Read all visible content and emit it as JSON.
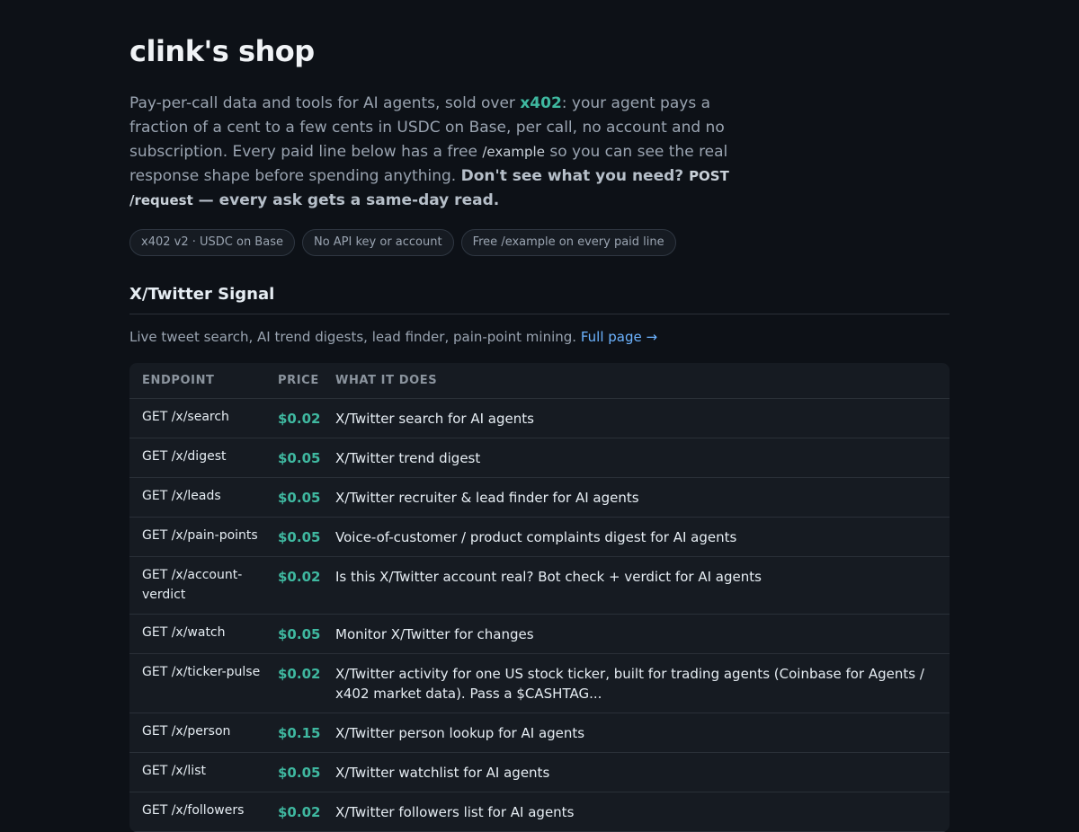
{
  "header": {
    "title": "clink's shop"
  },
  "intro": {
    "part1": "Pay-per-call data and tools for AI agents, sold over ",
    "accent": "x402",
    "part2": ": your agent pays a fraction of a cent to a few cents in USDC on Base, per call, no account and no subscription. Every paid line below has a free ",
    "code1": "/example",
    "part3": " so you can see the real response shape before spending anything. ",
    "strong1": "Don't see what you need? ",
    "code2": "POST /request",
    "strong2": " — every ask gets a same-day read."
  },
  "badges": [
    "x402 v2 · USDC on Base",
    "No API key or account",
    "Free /example on every paid line"
  ],
  "section": {
    "title": "X/Twitter Signal",
    "description": "Live tweet search, AI trend digests, lead finder, pain-point mining.",
    "link": "Full page →"
  },
  "table": {
    "headers": [
      "ENDPOINT",
      "PRICE",
      "WHAT IT DOES"
    ],
    "rows": [
      {
        "endpoint": "GET /x/search",
        "price": "$0.02",
        "desc": "X/Twitter search for AI agents"
      },
      {
        "endpoint": "GET /x/digest",
        "price": "$0.05",
        "desc": "X/Twitter trend digest"
      },
      {
        "endpoint": "GET /x/leads",
        "price": "$0.05",
        "desc": "X/Twitter recruiter & lead finder for AI agents"
      },
      {
        "endpoint": "GET /x/pain-points",
        "price": "$0.05",
        "desc": "Voice-of-customer / product complaints digest for AI agents"
      },
      {
        "endpoint": "GET /x/account-verdict",
        "price": "$0.02",
        "desc": "Is this X/Twitter account real? Bot check + verdict for AI agents"
      },
      {
        "endpoint": "GET /x/watch",
        "price": "$0.05",
        "desc": "Monitor X/Twitter for changes"
      },
      {
        "endpoint": "GET /x/ticker-pulse",
        "price": "$0.02",
        "desc": "X/Twitter activity for one US stock ticker, built for trading agents (Coinbase for Agents / x402 market data). Pass a $CASHTAG..."
      },
      {
        "endpoint": "GET /x/person",
        "price": "$0.15",
        "desc": "X/Twitter person lookup for AI agents"
      },
      {
        "endpoint": "GET /x/list",
        "price": "$0.05",
        "desc": "X/Twitter watchlist for AI agents"
      },
      {
        "endpoint": "GET /x/followers",
        "price": "$0.02",
        "desc": "X/Twitter followers list for AI agents"
      }
    ]
  },
  "colors": {
    "background": "#0d1117",
    "accent": "#3fb8a0",
    "link": "#6cb3ff"
  }
}
